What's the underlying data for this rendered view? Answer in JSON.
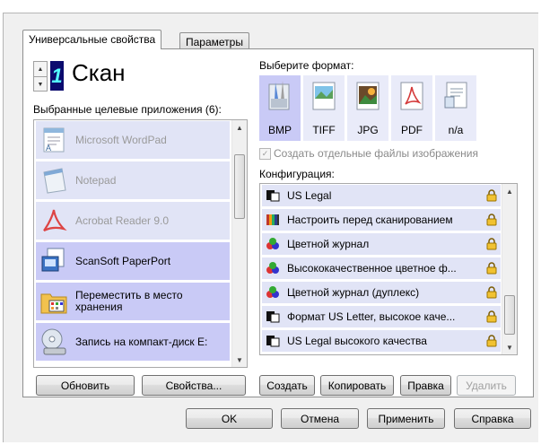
{
  "tabs": [
    {
      "label": "Универсальные свойства",
      "active": true
    },
    {
      "label": "Параметры",
      "active": false
    }
  ],
  "profile": {
    "number": "1",
    "title": "Скан"
  },
  "apps": {
    "header": "Выбранные целевые приложения (6):",
    "items": [
      {
        "label": "Microsoft WordPad",
        "state": "dim",
        "icon": "wordpad-icon"
      },
      {
        "label": "Notepad",
        "state": "dim",
        "icon": "notepad-icon"
      },
      {
        "label": "Acrobat Reader 9.0",
        "state": "dim",
        "icon": "acrobat-icon"
      },
      {
        "label": "ScanSoft PaperPort",
        "state": "selected",
        "icon": "paperport-icon"
      },
      {
        "label": "Переместить в место хранения",
        "state": "selected",
        "icon": "folder-icon"
      },
      {
        "label": "Запись на компакт-диск E:",
        "state": "selected",
        "icon": "cd-burn-icon"
      }
    ],
    "refresh_label": "Обновить",
    "properties_label": "Свойства..."
  },
  "format": {
    "header": "Выберите формат:",
    "options": [
      {
        "label": "BMP",
        "selected": true
      },
      {
        "label": "TIFF",
        "selected": false
      },
      {
        "label": "JPG",
        "selected": false
      },
      {
        "label": "PDF",
        "selected": false
      },
      {
        "label": "n/a",
        "selected": false
      }
    ],
    "separate_files_label": "Создать отдельные файлы изображения"
  },
  "config": {
    "header": "Конфигурация:",
    "items": [
      {
        "label": "US Legal",
        "icon": "bw-page-icon"
      },
      {
        "label": "Настроить перед сканированием",
        "icon": "configure-icon"
      },
      {
        "label": "Цветной журнал",
        "icon": "color-page-icon"
      },
      {
        "label": "Высококачественное цветное ф...",
        "icon": "color-page-icon"
      },
      {
        "label": "Цветной журнал (дуплекс)",
        "icon": "color-page-icon"
      },
      {
        "label": "Формат US Letter, высокое каче...",
        "icon": "bw-page-icon"
      },
      {
        "label": "US Legal высокого качества",
        "icon": "bw-page-icon"
      }
    ],
    "create_label": "Создать",
    "copy_label": "Копировать",
    "edit_label": "Правка",
    "delete_label": "Удалить"
  },
  "footer": {
    "ok_label": "OK",
    "cancel_label": "Отмена",
    "apply_label": "Применить",
    "help_label": "Справка"
  },
  "colors": {
    "selected_bg": "#c9caf6",
    "dim_bg": "#e1e4f6",
    "counter_bg": "#0b0b6e",
    "counter_fg": "#55ffff"
  }
}
